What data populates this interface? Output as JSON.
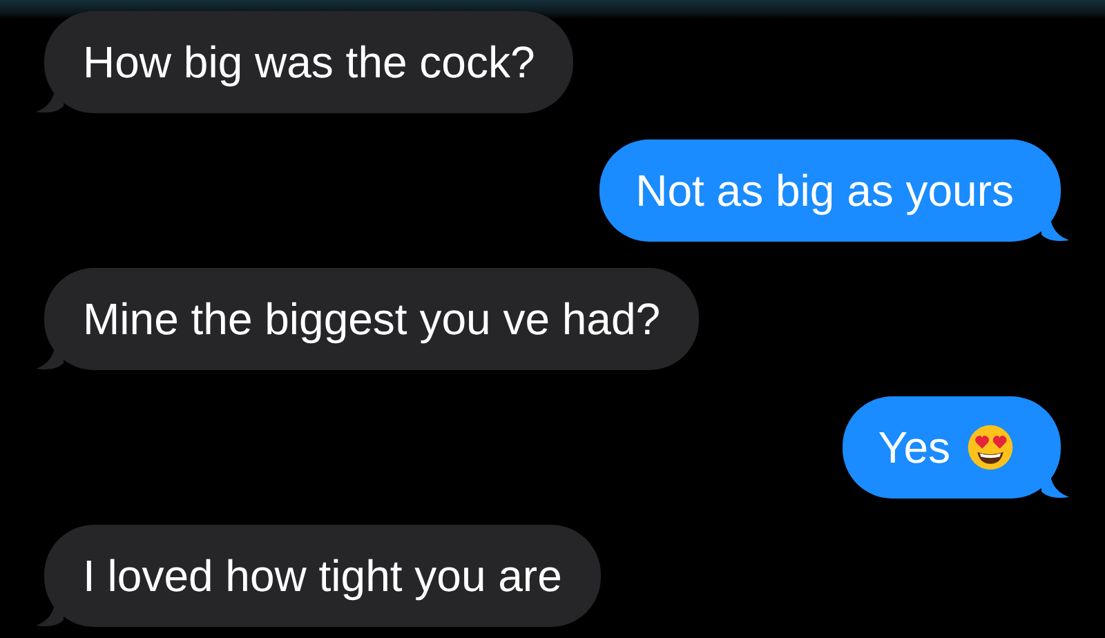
{
  "messages": [
    {
      "kind": "received",
      "text": "How big was the cock?"
    },
    {
      "kind": "sent",
      "text": "Not as big as yours"
    },
    {
      "kind": "received",
      "text": "Mine the biggest you ve had?"
    },
    {
      "kind": "sent",
      "text": "Yes",
      "emoji": {
        "kind": "heart-eyes"
      }
    },
    {
      "kind": "received",
      "text": "I loved how tight you are"
    }
  ]
}
